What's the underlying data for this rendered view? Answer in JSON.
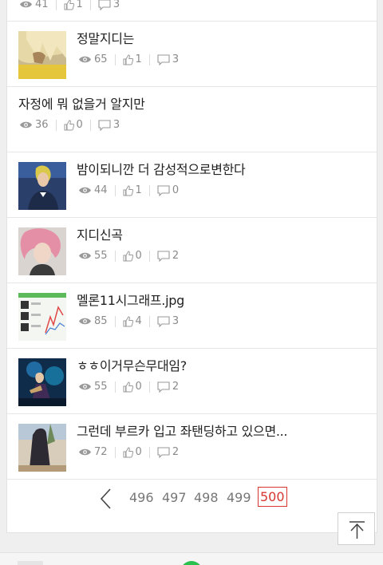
{
  "posts": [
    {
      "title": "",
      "views": "41",
      "likes": "1",
      "comments": "3",
      "thumb": "none"
    },
    {
      "title": "정말지디는",
      "views": "65",
      "likes": "1",
      "comments": "3",
      "thumb": "blonde-hair"
    },
    {
      "title": "자정에 뭐 없을거 알지만",
      "views": "36",
      "likes": "0",
      "comments": "3",
      "thumb": "none"
    },
    {
      "title": "밤이되니깐 더 감성적으로변한다",
      "views": "44",
      "likes": "1",
      "comments": "0",
      "thumb": "stage-portrait"
    },
    {
      "title": "지디신곡",
      "views": "55",
      "likes": "0",
      "comments": "2",
      "thumb": "pink-hair"
    },
    {
      "title": "멜론11시그래프.jpg",
      "views": "85",
      "likes": "4",
      "comments": "3",
      "thumb": "chart-screenshot"
    },
    {
      "title": "ㅎㅎ이거무슨무대임?",
      "views": "55",
      "likes": "0",
      "comments": "2",
      "thumb": "stage-blue"
    },
    {
      "title": "그런데 부르카 입고 좌탠딩하고 있으면...",
      "views": "72",
      "likes": "0",
      "comments": "2",
      "thumb": "burqa"
    }
  ],
  "pagination": {
    "pages": [
      "496",
      "497",
      "498",
      "499",
      "500"
    ],
    "current": "500"
  },
  "icons": {
    "views": "eye-icon",
    "likes": "thumbs-up-icon",
    "comments": "comment-icon",
    "prev": "chevron-left-icon",
    "top": "scroll-top-icon"
  },
  "colors": {
    "active_page": "#d8352f",
    "meta_text": "#8a8a8a",
    "accent_green": "#2ac14e"
  }
}
